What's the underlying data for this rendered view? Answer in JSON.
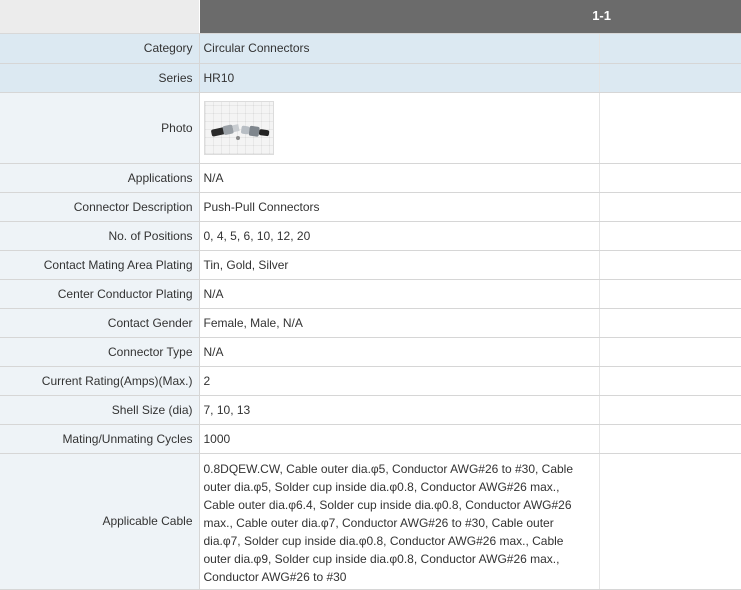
{
  "header": {
    "column_title": "1-1"
  },
  "rows": [
    {
      "label": "Category",
      "value": "Circular Connectors"
    },
    {
      "label": "Series",
      "value": "HR10"
    },
    {
      "label": "Photo",
      "value": ""
    },
    {
      "label": "Applications",
      "value": "N/A"
    },
    {
      "label": "Connector Description",
      "value": "Push-Pull Connectors"
    },
    {
      "label": "No. of Positions",
      "value": "0, 4, 5, 6, 10, 12, 20"
    },
    {
      "label": "Contact Mating Area Plating",
      "value": "Tin, Gold, Silver"
    },
    {
      "label": "Center Conductor Plating",
      "value": "N/A"
    },
    {
      "label": "Contact Gender",
      "value": "Female, Male, N/A"
    },
    {
      "label": "Connector Type",
      "value": "N/A"
    },
    {
      "label": "Current Rating(Amps)(Max.)",
      "value": "2"
    },
    {
      "label": "Shell Size (dia)",
      "value": "7, 10, 13"
    },
    {
      "label": "Mating/Unmating Cycles",
      "value": "1000"
    },
    {
      "label": "Applicable Cable",
      "value": "0.8DQEW.CW, Cable outer dia.φ5, Conductor AWG#26 to #30, Cable outer dia.φ5, Solder cup inside dia.φ0.8, Conductor AWG#26 max., Cable outer dia.φ6.4, Solder cup inside dia.φ0.8, Conductor AWG#26 max., Cable outer dia.φ7, Conductor AWG#26 to #30, Cable outer dia.φ7, Solder cup inside dia.φ0.8, Conductor AWG#26 max., Cable outer dia.φ9, Solder cup inside dia.φ0.8, Conductor AWG#26 max., Conductor AWG#26 to #30"
    }
  ],
  "icons": {
    "photo": "connector-photo"
  }
}
